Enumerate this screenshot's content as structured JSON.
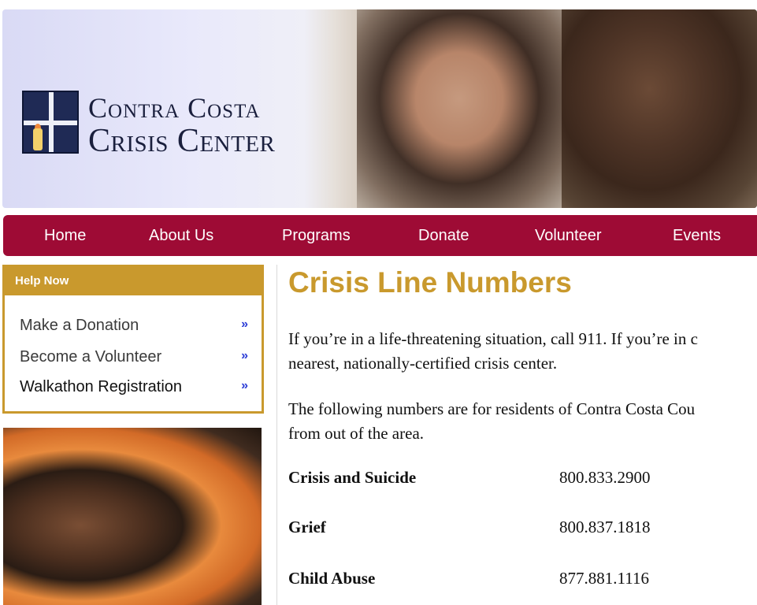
{
  "header": {
    "logo_line1": "Contra Costa",
    "logo_line2": "Crisis Center"
  },
  "nav": {
    "items": [
      "Home",
      "About Us",
      "Programs",
      "Donate",
      "Volunteer",
      "Events"
    ]
  },
  "sidebar": {
    "help_title": "Help Now",
    "items": [
      {
        "label": "Make a Donation",
        "arrow": "»"
      },
      {
        "label": "Become a Volunteer",
        "arrow": "»"
      },
      {
        "label": "Walkathon Registration",
        "arrow": "»"
      }
    ]
  },
  "main": {
    "title": "Crisis Line Numbers",
    "para1_line1": "If you’re in a life-threatening situation, call 911. If you’re in c",
    "para1_line2": "nearest, nationally-certified crisis center.",
    "para2_line1": "The following numbers are for residents of Contra Costa Cou",
    "para2_line2": "from out of the area.",
    "numbers": [
      {
        "label": "Crisis and Suicide",
        "value": "800.833.2900"
      },
      {
        "label": "Grief",
        "value": "800.837.1818"
      },
      {
        "label": "Child Abuse",
        "value": "877.881.1116"
      }
    ]
  }
}
